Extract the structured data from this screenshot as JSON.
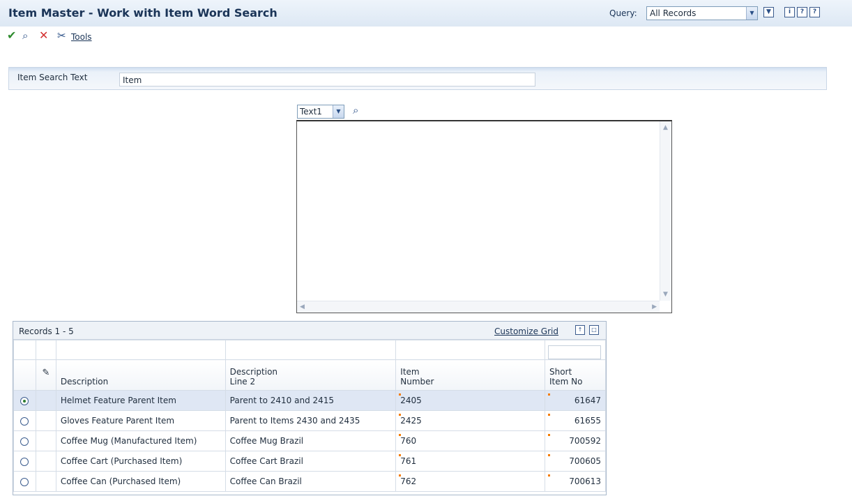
{
  "window": {
    "title": "Item Master - Work with Item Word Search",
    "query_label": "Query:",
    "query_value": "All Records"
  },
  "header_icons": [
    "filter-icon",
    "info-icon",
    "help-icon",
    "context-help-icon"
  ],
  "toolbar": {
    "select_icon": "checkmark-icon",
    "find_icon": "find-icon",
    "close_icon": "close-x-icon",
    "tools_icon": "tools-icon",
    "tools_label": "Tools"
  },
  "search": {
    "label": "Item Search Text",
    "value": "Item"
  },
  "text_panel": {
    "select_value": "Text1",
    "textarea_value": ""
  },
  "grid": {
    "records_label": "Records 1 - 5",
    "customize_label": "Customize Grid",
    "columns": [
      {
        "line1": "",
        "line2": "Description"
      },
      {
        "line1": "Description",
        "line2": "Line 2"
      },
      {
        "line1": "Item",
        "line2": "Number"
      },
      {
        "line1": "Short",
        "line2": "Item No"
      }
    ],
    "rows": [
      {
        "description": "Helmet Feature Parent Item",
        "description2": "Parent to 2410 and 2415",
        "item_number": "2405",
        "short_item": "61647",
        "selected": true
      },
      {
        "description": "Gloves Feature Parent Item",
        "description2": "Parent to Items 2430 and 2435",
        "item_number": "2425",
        "short_item": "61655",
        "selected": false
      },
      {
        "description": "Coffee Mug (Manufactured Item)",
        "description2": "Coffee Mug Brazil",
        "item_number": "760",
        "short_item": "700592",
        "selected": false
      },
      {
        "description": "Coffee Cart (Purchased Item)",
        "description2": "Coffee Cart Brazil",
        "item_number": "761",
        "short_item": "700605",
        "selected": false
      },
      {
        "description": "Coffee Can (Purchased Item)",
        "description2": "Coffee Can Brazil",
        "item_number": "762",
        "short_item": "700613",
        "selected": false
      }
    ]
  },
  "colors": {
    "title": "#1a3457",
    "accent": "#2a4f86",
    "selected_row": "#dfe7f4",
    "flag": "#f57c00"
  }
}
